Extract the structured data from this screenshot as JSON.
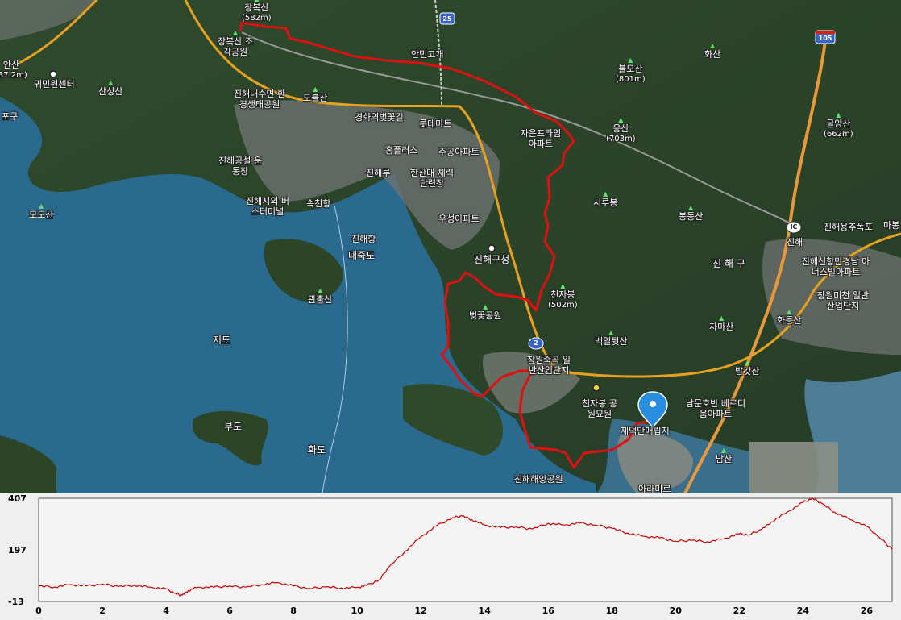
{
  "map": {
    "labels": [
      {
        "id": "jangboksan",
        "text": "장복산",
        "sub": "(582m)",
        "peak": true
      },
      {
        "id": "jangboksan-park",
        "text": "장복산 조각공원"
      },
      {
        "id": "gwiminwon",
        "text": "귀민원센터"
      },
      {
        "id": "ansan",
        "text": "안산",
        "sub": "(37.2m)"
      },
      {
        "id": "sangsan",
        "text": "산성산",
        "peak": true
      },
      {
        "id": "harbor-west",
        "text": "포구"
      },
      {
        "id": "env-park",
        "text": "진해내수면 환경생태공원"
      },
      {
        "id": "dobulsan",
        "text": "도불산",
        "peak": true
      },
      {
        "id": "anmin-pass",
        "text": "안민고개"
      },
      {
        "id": "gyeonghwa",
        "text": "경화역벚꽃길"
      },
      {
        "id": "lotte",
        "text": "롯데마트"
      },
      {
        "id": "homeplus",
        "text": "홈플러스"
      },
      {
        "id": "jugong",
        "text": "주공아파트"
      },
      {
        "id": "xi-apt",
        "text": "자은프라임 아파트"
      },
      {
        "id": "bulmosan",
        "text": "불모산",
        "sub": "(801m)",
        "peak": true
      },
      {
        "id": "hwasan",
        "text": "화산",
        "peak": true
      },
      {
        "id": "ungsan",
        "text": "웅산",
        "sub": "(703m)",
        "peak": true
      },
      {
        "id": "gulamsan",
        "text": "굴암산",
        "sub": "(662m)",
        "peak": true
      },
      {
        "id": "stadium",
        "text": "진해공설 운동장"
      },
      {
        "id": "jinhaeru",
        "text": "진해루"
      },
      {
        "id": "fitness",
        "text": "한산대 체력단련장"
      },
      {
        "id": "terminal",
        "text": "진해시외 버스터미널"
      },
      {
        "id": "sokcheon",
        "text": "속천항"
      },
      {
        "id": "modosan",
        "text": "모도산",
        "peak": true
      },
      {
        "id": "sirubong",
        "text": "시루봉",
        "peak": true
      },
      {
        "id": "bongdongsan",
        "text": "봉동산",
        "peak": true
      },
      {
        "id": "woosung",
        "text": "우성아파트"
      },
      {
        "id": "jinhae-port",
        "text": "진해항"
      },
      {
        "id": "daejukdo",
        "text": "대죽도"
      },
      {
        "id": "jinhaegu-office",
        "text": "진해구청"
      },
      {
        "id": "jinhaegu",
        "text": "진 해 구"
      },
      {
        "id": "jinhae-ic",
        "text": "진해"
      },
      {
        "id": "waterfall",
        "text": "진해용추폭포"
      },
      {
        "id": "masan",
        "text": "마봉"
      },
      {
        "id": "newport-apt",
        "text": "진해신항만경남 아너스빌아파트"
      },
      {
        "id": "gwanchulsan",
        "text": "관출산",
        "peak": true
      },
      {
        "id": "cheonjabong",
        "text": "천자봉",
        "sub": "(502m)",
        "peak": true
      },
      {
        "id": "beot-park",
        "text": "벚꽃공원",
        "peak": true
      },
      {
        "id": "jeodo",
        "text": "저도"
      },
      {
        "id": "baegil",
        "text": "백일뒷산",
        "peak": true
      },
      {
        "id": "jamasan",
        "text": "자마산",
        "peak": true
      },
      {
        "id": "hwadeungsan",
        "text": "화등산",
        "peak": true
      },
      {
        "id": "industrial",
        "text": "창원미천 일반산업단지"
      },
      {
        "id": "changwon-ind",
        "text": "창원죽곡 일반산업단지"
      },
      {
        "id": "bamgatsan",
        "text": "밤갓산",
        "peak": true
      },
      {
        "id": "cemetery",
        "text": "천자봉 공원묘원"
      },
      {
        "id": "namun-apt",
        "text": "남문호반 베르디움아파트"
      },
      {
        "id": "budo",
        "text": "부도"
      },
      {
        "id": "landfill",
        "text": "제덕만매립지"
      },
      {
        "id": "hwado",
        "text": "화도"
      },
      {
        "id": "namsan",
        "text": "남산",
        "peak": true
      },
      {
        "id": "marine-park",
        "text": "진해해양공원"
      },
      {
        "id": "arami",
        "text": "아라미르"
      }
    ],
    "road_shields": [
      {
        "id": "r25",
        "text": "25",
        "color": "#3a63c8"
      },
      {
        "id": "r105",
        "text": "105",
        "color": "#3a63c8"
      },
      {
        "id": "r2",
        "text": "2",
        "color": "#3a63c8"
      },
      {
        "id": "ic",
        "text": "IC",
        "color": "#ffffff"
      }
    ],
    "colors": {
      "water": "#2a6a8f",
      "track": "#e01010",
      "road_main": "#f0a020",
      "marker": "#2a8ee0"
    }
  },
  "chart_data": {
    "type": "line",
    "x_ticks": [
      "0",
      "2",
      "4",
      "6",
      "8",
      "10",
      "12",
      "14",
      "16",
      "18",
      "20",
      "22",
      "24",
      "26"
    ],
    "y_ticks": [
      "407",
      "197",
      "-13"
    ],
    "xlim": [
      0,
      26.8
    ],
    "ylim": [
      -13,
      407
    ],
    "grid": false,
    "series": [
      {
        "color": "#cc0000",
        "x": [
          0,
          0.5,
          1,
          1.5,
          2,
          2.5,
          3,
          3.5,
          4,
          4.3,
          4.5,
          4.7,
          5,
          5.5,
          6,
          6.5,
          7,
          7.5,
          8,
          8.5,
          9,
          9.5,
          10,
          10.3,
          10.7,
          11,
          11.5,
          12,
          12.5,
          13,
          13.3,
          13.6,
          14,
          14.5,
          15,
          15.5,
          16,
          16.5,
          17,
          17.5,
          18,
          18.5,
          19,
          19.5,
          20,
          20.5,
          21,
          21.5,
          22,
          22.3,
          22.7,
          23,
          23.5,
          24,
          24.3,
          24.6,
          25,
          25.5,
          26,
          26.4,
          26.8
        ],
        "y": [
          50,
          46,
          56,
          50,
          58,
          48,
          53,
          45,
          38,
          20,
          12,
          32,
          45,
          45,
          50,
          45,
          56,
          64,
          50,
          40,
          46,
          42,
          44,
          52,
          75,
          128,
          190,
          250,
          295,
          328,
          335,
          320,
          298,
          288,
          290,
          282,
          305,
          298,
          306,
          298,
          285,
          265,
          252,
          246,
          232,
          236,
          230,
          242,
          262,
          258,
          280,
          310,
          350,
          390,
          407,
          385,
          350,
          320,
          292,
          248,
          200
        ]
      }
    ]
  }
}
